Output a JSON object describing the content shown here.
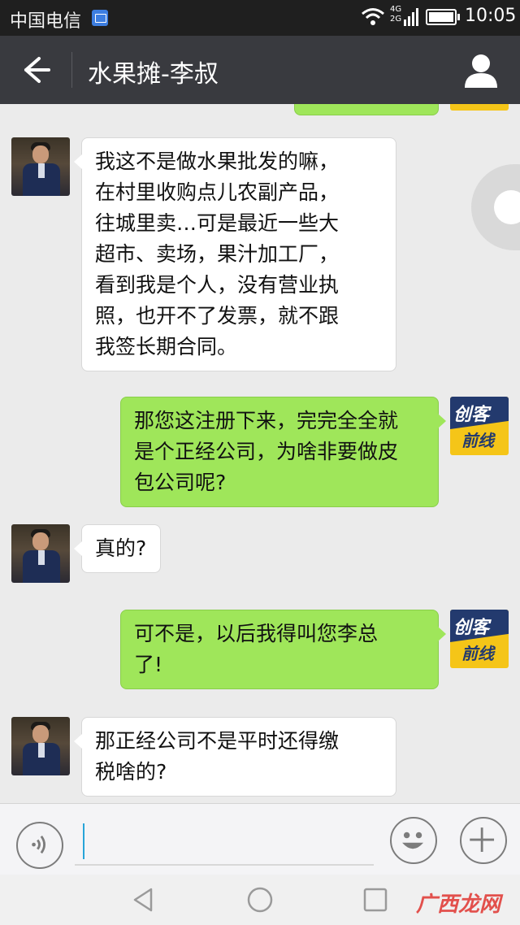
{
  "status_bar": {
    "carrier": "中国电信",
    "network": [
      "4G",
      "2G"
    ],
    "time": "10:05"
  },
  "header": {
    "title": "水果摊-李叔",
    "back_icon": "back-arrow-icon",
    "profile_icon": "person-icon"
  },
  "messages": [
    {
      "side": "left",
      "text": "我这不是做水果批发的嘛，\n在村里收购点儿农副产品，\n往城里卖…可是最近一些大\n超市、卖场，果汁加工厂，\n看到我是个人，没有营业执\n照，也开不了发票，就不跟\n我签长期合同。"
    },
    {
      "side": "right",
      "text": "那您这注册下来，完完全全就\n是个正经公司，为啥非要做皮\n包公司呢?"
    },
    {
      "side": "left",
      "text": "真的?"
    },
    {
      "side": "right",
      "text": "可不是，以后我得叫您李总\n了!"
    },
    {
      "side": "left",
      "text": "那正经公司不是平时还得缴\n税啥的?"
    }
  ],
  "right_avatar": {
    "line1": "创客",
    "line2": "前线"
  },
  "input_bar": {
    "voice_icon": "voice-icon",
    "emoji_icon": "emoji-icon",
    "add_icon": "plus-icon"
  },
  "watermark": "广西龙网",
  "colors": {
    "header_bg": "#393a3f",
    "outgoing_bubble": "#9fe65a",
    "incoming_bubble": "#ffffff",
    "chat_bg": "#ebebeb"
  }
}
